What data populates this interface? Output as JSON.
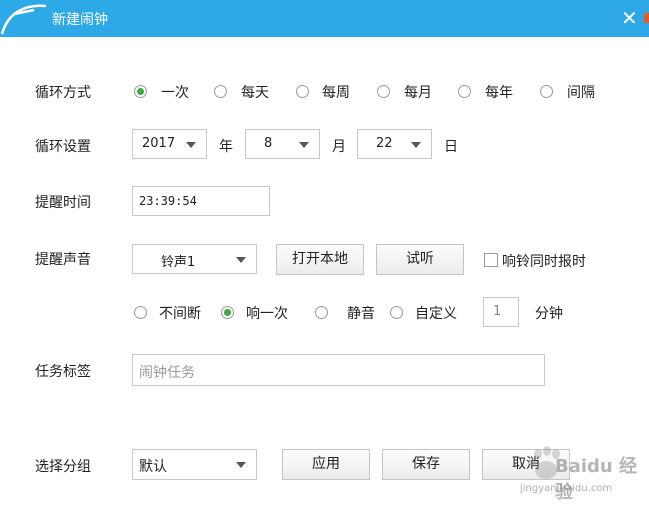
{
  "window": {
    "title": "新建闹钟",
    "close_glyph": "✕"
  },
  "cycle_mode": {
    "label": "循环方式",
    "options": [
      "一次",
      "每天",
      "每周",
      "每月",
      "每年",
      "间隔"
    ],
    "selected": "一次"
  },
  "cycle_setting": {
    "label": "循环设置",
    "year": "2017",
    "year_unit": "年",
    "month": "8",
    "month_unit": "月",
    "day": "22",
    "day_unit": "日"
  },
  "reminder_time": {
    "label": "提醒时间",
    "value": "23:39:54"
  },
  "reminder_sound": {
    "label": "提醒声音",
    "sound": "铃声1",
    "open_local_label": "打开本地",
    "preview_label": "试听",
    "announce_time_label": "响铃同时报时",
    "announce_time_checked": false,
    "modes": [
      "不间断",
      "响一次",
      "静音",
      "自定义"
    ],
    "selected_mode": "响一次",
    "custom_minutes": "1",
    "minutes_unit": "分钟"
  },
  "task_tag": {
    "label": "任务标签",
    "placeholder": "闹钟任务"
  },
  "group": {
    "label": "选择分组",
    "value": "默认",
    "apply_label": "应用",
    "save_label": "保存",
    "cancel_label": "取消"
  },
  "watermark": {
    "brand": "Baidu 经验",
    "url": "jingyan.baidu.com"
  },
  "colors": {
    "titlebar": "#2ea9e8",
    "radio_selected": "#3caa3c"
  }
}
